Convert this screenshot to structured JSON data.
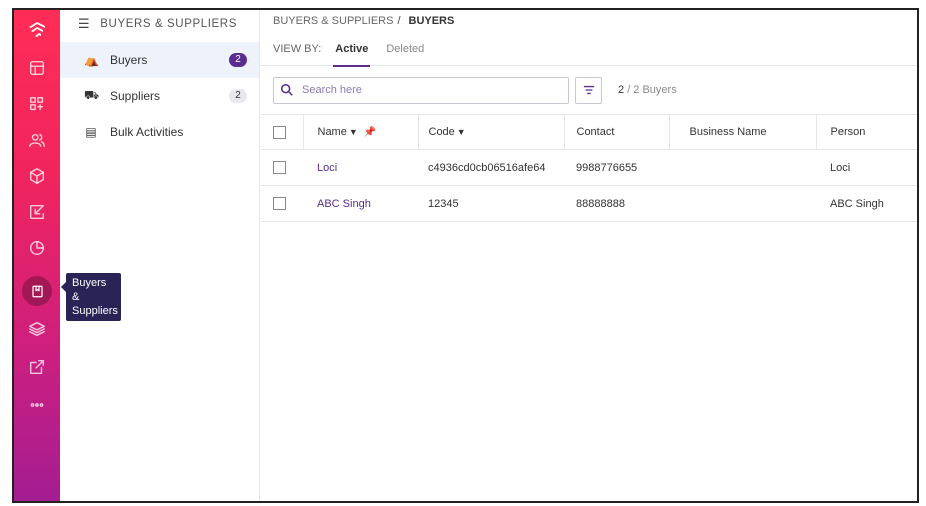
{
  "tooltip": {
    "text": "Buyers & Suppliers"
  },
  "rail": {
    "items": [
      {
        "icon": "logo-icon"
      },
      {
        "icon": "dashboard-icon"
      },
      {
        "icon": "grid-icon"
      },
      {
        "icon": "users-icon"
      },
      {
        "icon": "box-icon"
      },
      {
        "icon": "import-icon"
      },
      {
        "icon": "chart-pie-icon"
      },
      {
        "icon": "book-icon",
        "active": true
      },
      {
        "icon": "layers-icon"
      },
      {
        "icon": "external-link-icon"
      },
      {
        "icon": "more-icon"
      }
    ],
    "gradient_top": "#ff2d55",
    "gradient_bottom": "#a41d92"
  },
  "side_panel": {
    "title": "BUYERS & SUPPLIERS",
    "items": [
      {
        "label": "Buyers",
        "badge": "2",
        "icon": "buyer-icon",
        "active": true
      },
      {
        "label": "Suppliers",
        "badge": "2",
        "icon": "supplier-icon"
      },
      {
        "label": "Bulk Activities",
        "icon": "bulk-icon"
      }
    ]
  },
  "breadcrumb": {
    "parent": "BUYERS & SUPPLIERS",
    "separator": "/",
    "current": "BUYERS"
  },
  "view_by": {
    "label": "VIEW BY:",
    "tabs": [
      "Active",
      "Deleted"
    ],
    "active": "Active"
  },
  "search": {
    "placeholder": "Search here",
    "value": ""
  },
  "count": {
    "selected": "2",
    "rest": "/ 2 Buyers"
  },
  "table": {
    "headers": {
      "name": "Name",
      "code": "Code",
      "contact": "Contact",
      "business": "Business Name",
      "person": "Person"
    },
    "rows": [
      {
        "name": "Loci",
        "code": "c4936cd0cb06516afe64",
        "contact": "9988776655",
        "business": "",
        "person": "Loci"
      },
      {
        "name": "ABC Singh",
        "code": "12345",
        "contact": "88888888",
        "business": "",
        "person": "ABC Singh"
      }
    ]
  },
  "accent_color": "#5b2d91"
}
